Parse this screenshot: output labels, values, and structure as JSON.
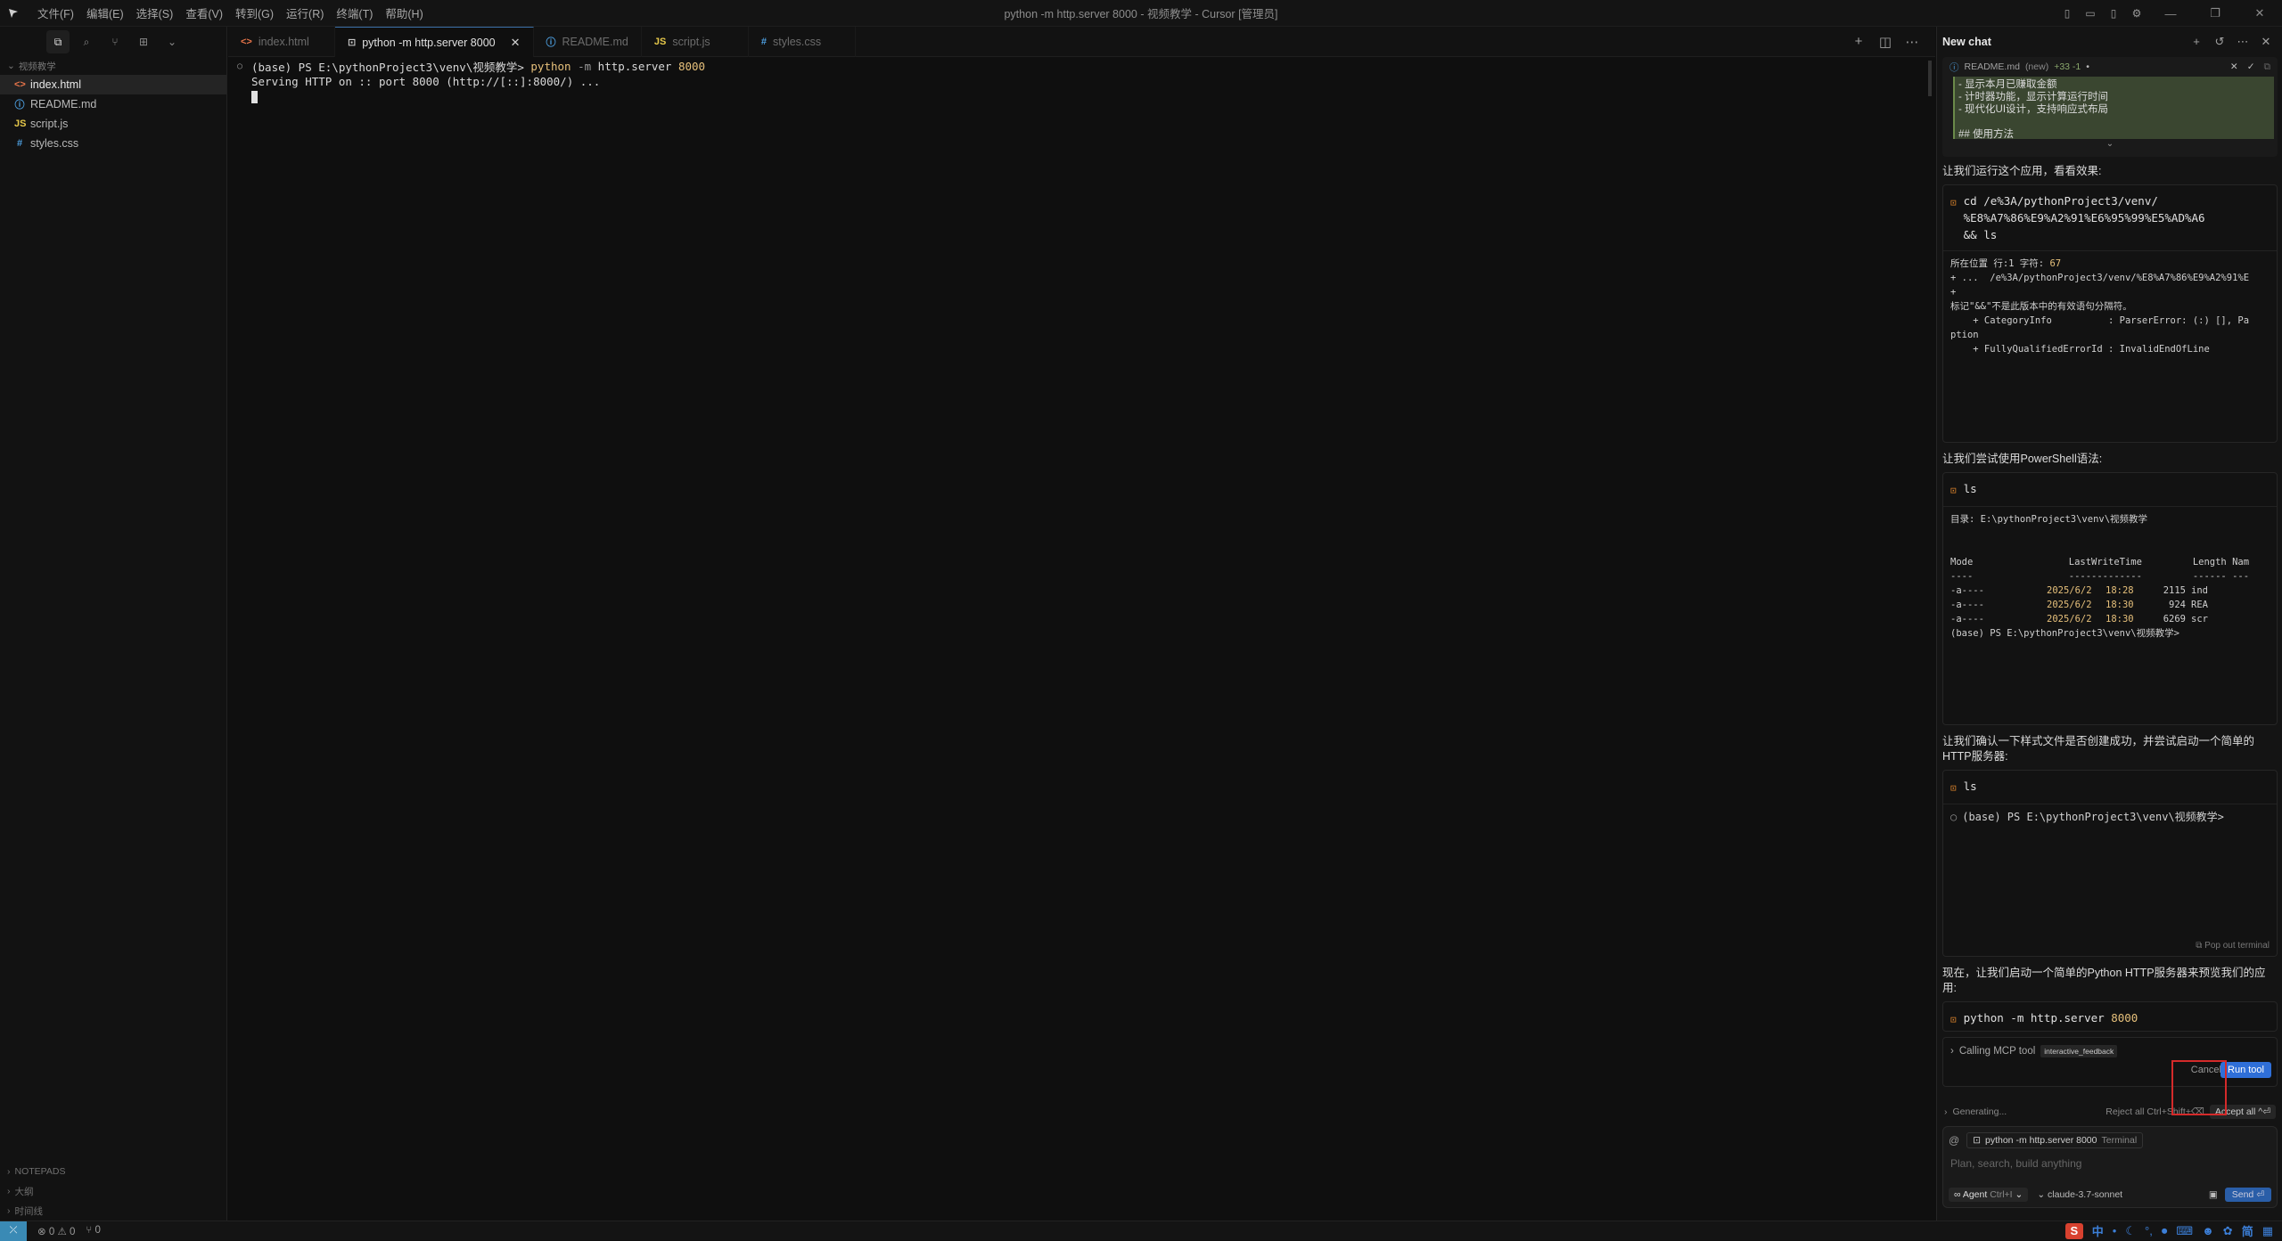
{
  "window": {
    "title": "python -m http.server 8000 - 视频教学 - Cursor [管理员]",
    "menu": [
      "文件(F)",
      "编辑(E)",
      "选择(S)",
      "查看(V)",
      "转到(G)",
      "运行(R)",
      "终端(T)",
      "帮助(H)"
    ]
  },
  "sidebar": {
    "folder": "视频教学",
    "files": [
      {
        "name": "index.html",
        "icon": "<>",
        "color": "#e8754a",
        "active": true
      },
      {
        "name": "README.md",
        "icon": "ⓘ",
        "color": "#4d9fe0",
        "active": false
      },
      {
        "name": "script.js",
        "icon": "JS",
        "color": "#e6c84a",
        "active": false
      },
      {
        "name": "styles.css",
        "icon": "#",
        "color": "#4d9fe0",
        "active": false
      }
    ],
    "bottom_sections": [
      "NOTEPADS",
      "大纲",
      "时间线"
    ]
  },
  "tabs": [
    {
      "label": "index.html",
      "icon": "<>",
      "color": "#e8754a",
      "active": false
    },
    {
      "label": "python -m http.server 8000",
      "icon": "⊡",
      "color": "#cccccc",
      "active": true
    },
    {
      "label": "README.md",
      "icon": "ⓘ",
      "color": "#4d9fe0",
      "active": false
    },
    {
      "label": "script.js",
      "icon": "JS",
      "color": "#e6c84a",
      "active": false
    },
    {
      "label": "styles.css",
      "icon": "#",
      "color": "#4d9fe0",
      "active": false
    }
  ],
  "terminal": {
    "prompt": "(base) PS E:\\pythonProject3\\venv\\视频教学> ",
    "cmd": "python",
    "flag": " -m",
    "args": " http.server",
    "port": " 8000",
    "output": "Serving HTTP on :: port 8000 (http://[::]:8000/) ..."
  },
  "chat": {
    "header_title": "New chat",
    "readme_card": {
      "file": "README.md",
      "status": "(new)",
      "diff": "+33 -1",
      "lines": [
        "- 显示本月已赚取金额",
        "- 计时器功能，显示计算运行时间",
        "- 现代化UI设计，支持响应式布局",
        "",
        "## 使用方法"
      ]
    },
    "msg1": "让我们运行这个应用，看看效果:",
    "tool1_cmd": "cd /e%3A/pythonProject3/venv/\n%E8%A7%86%E9%A2%91%E6%95%99%E5%AD%A6\n&& ls",
    "tool1_out_line1_pre": "所在位置 行:1 字符: ",
    "tool1_out_line1_num": "67",
    "tool1_out_rest": "+ ...  /e%3A/pythonProject3/venv/%E8%A7%86%E9%A2%91%E\n+\n标记\"&&\"不是此版本中的有效语句分隔符。\n    + CategoryInfo          : ParserError: (:) [], Pa\nption\n    + FullyQualifiedErrorId : InvalidEndOfLine",
    "msg2": "让我们尝试使用PowerShell语法:",
    "tool2_cmd": "ls",
    "tool2_dir": "目录: E:\\pythonProject3\\venv\\视频教学",
    "tool2_header": "Mode                 LastWriteTime         Length Nam\n----                 -------------         ------ ---",
    "tool2_rows": [
      {
        "mode": "-a----",
        "date": "2025/6/2",
        "time": "18:28",
        "len": "2115",
        "name": "ind"
      },
      {
        "mode": "-a----",
        "date": "2025/6/2",
        "time": "18:30",
        "len": "924",
        "name": "REA"
      },
      {
        "mode": "-a----",
        "date": "2025/6/2",
        "time": "18:30",
        "len": "6269",
        "name": "scr"
      }
    ],
    "tool2_prompt": "(base) PS E:\\pythonProject3\\venv\\视频教学>",
    "msg3": "让我们确认一下样式文件是否创建成功，并尝试启动一个简单的HTTP服务器:",
    "tool3_cmd": "ls",
    "tool3_out": "(base) PS E:\\pythonProject3\\venv\\视频教学>",
    "pop_out": "Pop out terminal",
    "msg4": "现在，让我们启动一个简单的Python HTTP服务器来预览我们的应用:",
    "tool4_cmd_pre": "python -m http.server ",
    "tool4_cmd_num": "8000",
    "mcp_label": "Calling MCP tool",
    "mcp_badge": "interactive_feedback",
    "cancel": "Cancel",
    "run_tool": "Run tool",
    "generating": "Generating...",
    "reject_all": "Reject all Ctrl+Shift+⌫",
    "accept_all": "Accept all ^⏎",
    "context_chip": "python -m http.server 8000",
    "context_chip_sub": "Terminal",
    "placeholder": "Plan, search, build anything",
    "agent_label": "Agent",
    "agent_key": "Ctrl+I",
    "model": "claude-3.7-sonnet",
    "send": "Send"
  },
  "status": {
    "errors": "0",
    "warnings": "0",
    "ports": "0"
  }
}
